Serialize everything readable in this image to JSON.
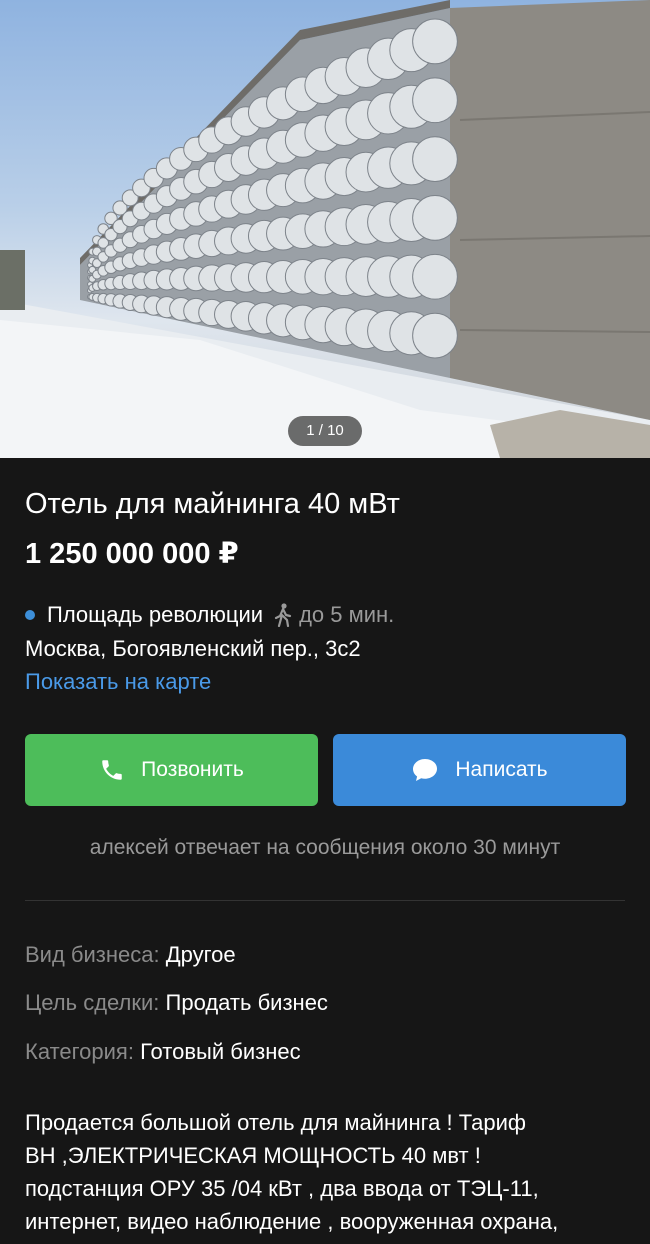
{
  "gallery": {
    "counter": "1 / 10"
  },
  "listing": {
    "title": "Отель для майнинга 40 мВт",
    "price": "1 250 000 000 ₽",
    "metro_station": "Площадь революции",
    "walk_time": "до 5 мин.",
    "address": "Москва, Богоявленский пер., 3с2",
    "map_link": "Показать на карте"
  },
  "actions": {
    "call_label": "Позвонить",
    "message_label": "Написать",
    "reply_note": "алексей отвечает на сообщения около 30 минут"
  },
  "properties": [
    {
      "key": "Вид бизнеса:",
      "value": "Другое"
    },
    {
      "key": "Цель сделки:",
      "value": "Продать бизнес"
    },
    {
      "key": "Категория:",
      "value": "Готовый бизнес"
    }
  ],
  "description": [
    "Продается большой отель для майнинга ! Тариф",
    "ВН ,ЭЛЕКТРИЧЕСКАЯ МОЩНОСТЬ 40 мвт !",
    "подстанция ОРУ 35 /04 кВт , два ввода от ТЭЦ-11,",
    "интернет, видео наблюдение , вооруженная охрана,"
  ],
  "icons": {
    "walk": "walking-person-icon",
    "call": "phone-icon",
    "message": "chat-bubble-icon"
  },
  "colors": {
    "background": "#161616",
    "call_button": "#4dbd5a",
    "message_button": "#3b8ad9",
    "link": "#4a9ae8",
    "metro_line": "#3d8fd9"
  }
}
